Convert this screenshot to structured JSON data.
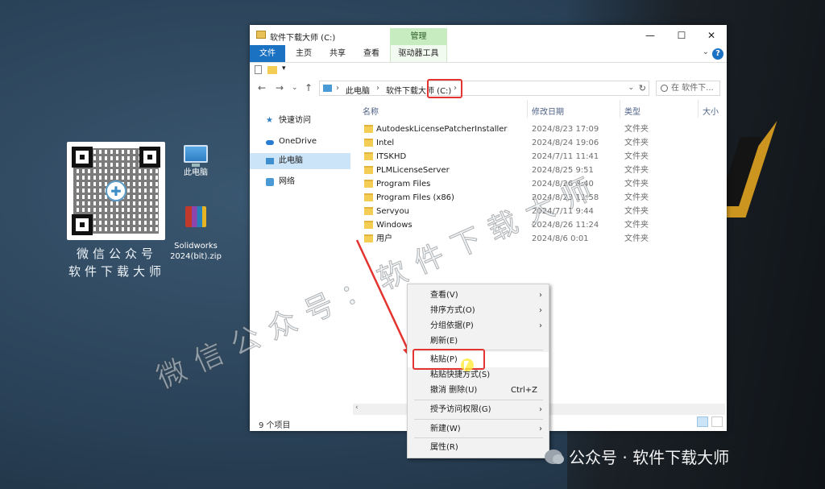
{
  "desktop": {
    "qr_caption_line1": "微信公众号",
    "qr_caption_line2": "软件下载大师",
    "icons": [
      {
        "label": "此电脑",
        "icon": "computer-icon"
      },
      {
        "label": "Solidworks\n2024(bit).zip",
        "icon": "winrar-archive-icon"
      }
    ],
    "watermark": "微信公众号：软件下载大师",
    "footer": "公众号 · 软件下载大师"
  },
  "window": {
    "title": "软件下载大师 (C:)",
    "manage_tab": "管理",
    "controls": {
      "minimize": "—",
      "maximize": "☐",
      "close": "✕"
    },
    "ribbon_tabs": [
      "文件",
      "主页",
      "共享",
      "查看",
      "驱动器工具"
    ],
    "help": "?",
    "address": {
      "segments": [
        "此电脑",
        "软件下载大师 (C:)"
      ],
      "sep": "›"
    },
    "search_placeholder": "在 软件下...",
    "sidebar": [
      {
        "label": "快速访问",
        "icon": "star-icon"
      },
      {
        "label": "OneDrive",
        "icon": "cloud-icon"
      },
      {
        "label": "此电脑",
        "icon": "computer-icon",
        "selected": true
      },
      {
        "label": "网络",
        "icon": "network-icon"
      }
    ],
    "columns": [
      "名称",
      "修改日期",
      "类型",
      "大小"
    ],
    "rows": [
      {
        "name": "AutodeskLicensePatcherInstaller",
        "date": "2024/8/23 17:09",
        "type": "文件夹"
      },
      {
        "name": "Intel",
        "date": "2024/8/24 19:06",
        "type": "文件夹"
      },
      {
        "name": "ITSKHD",
        "date": "2024/7/11 11:41",
        "type": "文件夹"
      },
      {
        "name": "PLMLicenseServer",
        "date": "2024/8/25 9:51",
        "type": "文件夹"
      },
      {
        "name": "Program Files",
        "date": "2024/8/26 8:40",
        "type": "文件夹"
      },
      {
        "name": "Program Files (x86)",
        "date": "2024/8/23 11:58",
        "type": "文件夹"
      },
      {
        "name": "Servyou",
        "date": "2024/7/11 9:44",
        "type": "文件夹"
      },
      {
        "name": "Windows",
        "date": "2024/8/26 11:24",
        "type": "文件夹"
      },
      {
        "name": "用户",
        "date": "2024/8/6 0:01",
        "type": "文件夹"
      }
    ],
    "status": "9 个项目"
  },
  "context_menu": {
    "items": [
      {
        "label": "查看(V)",
        "submenu": true
      },
      {
        "label": "排序方式(O)",
        "submenu": true
      },
      {
        "label": "分组依据(P)",
        "submenu": true
      },
      {
        "label": "刷新(E)"
      },
      {
        "sep": true
      },
      {
        "label": "粘贴(P)",
        "highlighted": true
      },
      {
        "label": "粘贴快捷方式(S)"
      },
      {
        "label": "撤消 删除(U)",
        "shortcut": "Ctrl+Z"
      },
      {
        "sep": true
      },
      {
        "label": "授予访问权限(G)",
        "submenu": true
      },
      {
        "sep": true
      },
      {
        "label": "新建(W)",
        "submenu": true
      },
      {
        "sep": true
      },
      {
        "label": "属性(R)"
      }
    ]
  },
  "colors": {
    "accent": "#1b71c2",
    "highlight_box": "#e3342f",
    "manage_tab": "#c6ecc0",
    "folder": "#f4cd55"
  }
}
